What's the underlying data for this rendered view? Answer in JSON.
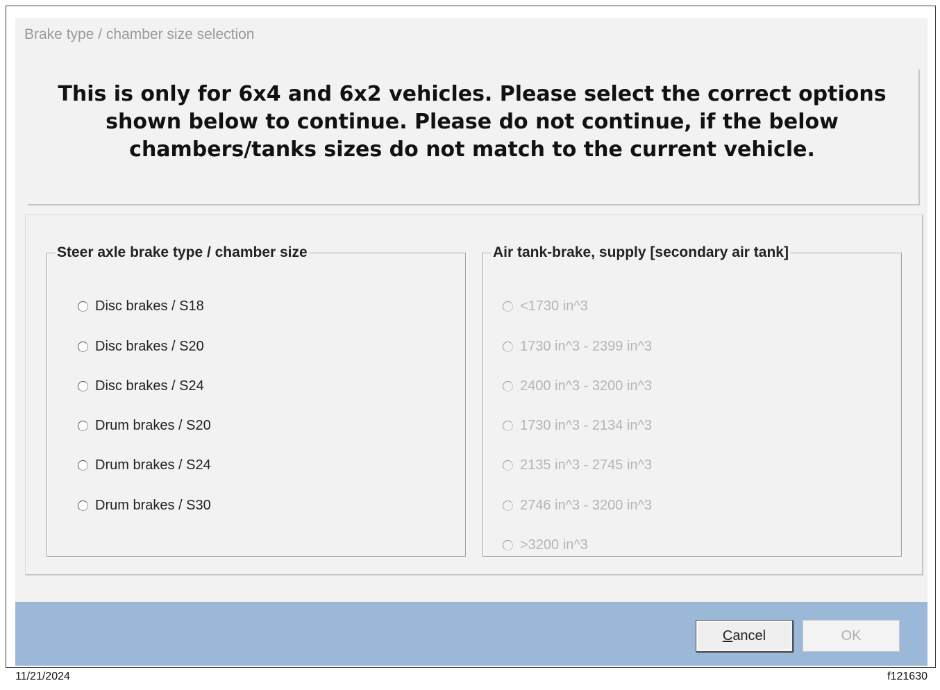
{
  "dialog": {
    "title": "Brake type / chamber size selection",
    "notice": "This is only for 6x4 and 6x2 vehicles. Please select the correct options shown below to continue. Please do not continue, if the below chambers/tanks sizes do not match to the current vehicle."
  },
  "steer_group": {
    "legend": "Steer axle brake type / chamber size",
    "options": [
      {
        "label": "Disc brakes / S18",
        "selected": false,
        "enabled": true
      },
      {
        "label": "Disc brakes / S20",
        "selected": false,
        "enabled": true
      },
      {
        "label": "Disc brakes / S24",
        "selected": false,
        "enabled": true
      },
      {
        "label": "Drum brakes / S20",
        "selected": false,
        "enabled": true
      },
      {
        "label": "Drum brakes / S24",
        "selected": false,
        "enabled": true
      },
      {
        "label": "Drum brakes / S30",
        "selected": false,
        "enabled": true
      }
    ]
  },
  "tank_group": {
    "legend": "Air tank-brake, supply [secondary air tank]",
    "options": [
      {
        "label": "<1730 in^3",
        "selected": false,
        "enabled": false
      },
      {
        "label": "1730 in^3 - 2399 in^3",
        "selected": false,
        "enabled": false
      },
      {
        "label": "2400 in^3 - 3200 in^3",
        "selected": false,
        "enabled": false
      },
      {
        "label": "1730 in^3 - 2134 in^3",
        "selected": false,
        "enabled": false
      },
      {
        "label": "2135 in^3 - 2745 in^3",
        "selected": false,
        "enabled": false
      },
      {
        "label": "2746 in^3 - 3200 in^3",
        "selected": false,
        "enabled": false
      },
      {
        "label": ">3200 in^3",
        "selected": false,
        "enabled": false
      }
    ]
  },
  "buttons": {
    "cancel_mnemonic": "C",
    "cancel_rest": "ancel",
    "ok": "OK",
    "ok_enabled": false
  },
  "footer": {
    "date": "11/21/2024",
    "figure_id": "f121630"
  }
}
